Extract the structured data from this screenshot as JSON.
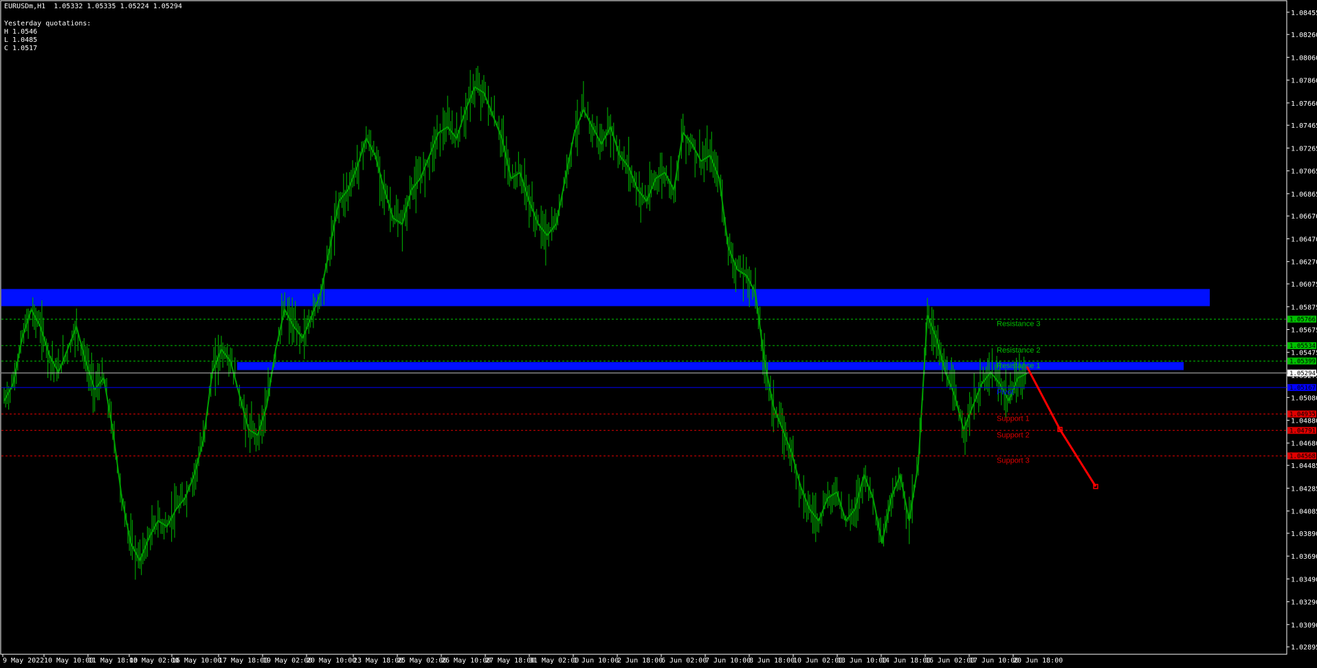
{
  "header": {
    "symbol_line": "EURUSDm,H1  1.05332 1.05335 1.05224 1.05294",
    "yesterday_title": "Yesterday quotations:",
    "yesterday_high": "H 1.0546",
    "yesterday_low": "L 1.0485",
    "yesterday_close": "C 1.0517"
  },
  "colors": {
    "background": "#000000",
    "candles": "#00a000",
    "zone": "#0010ff",
    "resistance": "#00c000",
    "support": "#e00000",
    "pivot": "#0000ff",
    "axis": "#ffffff",
    "forecast_arrow": "#ff0000"
  },
  "chart_data": {
    "type": "line",
    "title": "EURUSDm,H1",
    "ylim": [
      1.0283,
      1.0855
    ],
    "y_ticks": [
      "1.08455",
      "1.08260",
      "1.08060",
      "1.07860",
      "1.07660",
      "1.07465",
      "1.07265",
      "1.07065",
      "1.06865",
      "1.06670",
      "1.06470",
      "1.06270",
      "1.06075",
      "1.05875",
      "1.05675",
      "1.05475",
      "1.05275",
      "1.05080",
      "1.04880",
      "1.04680",
      "1.04485",
      "1.04285",
      "1.04085",
      "1.03890",
      "1.03690",
      "1.03490",
      "1.03290",
      "1.03090",
      "1.02895"
    ],
    "x_ticks": [
      "9 May 2022",
      "10 May 10:00",
      "11 May 18:00",
      "13 May 02:00",
      "16 May 10:00",
      "17 May 18:00",
      "19 May 02:00",
      "20 May 10:00",
      "23 May 18:00",
      "25 May 02:00",
      "26 May 10:00",
      "27 May 18:00",
      "31 May 02:00",
      "1 Jun 10:00",
      "2 Jun 18:00",
      "6 Jun 02:00",
      "7 Jun 10:00",
      "8 Jun 18:00",
      "10 Jun 02:00",
      "13 Jun 10:00",
      "14 Jun 18:00",
      "16 Jun 02:00",
      "17 Jun 10:00",
      "20 Jun 18:00"
    ],
    "series": [
      {
        "values": [
          1.0505,
          1.052,
          1.056,
          1.0585,
          1.057,
          1.0545,
          1.053,
          1.055,
          1.057,
          1.054,
          1.0515,
          1.0525,
          1.048,
          1.042,
          1.038,
          1.0365,
          1.0385,
          1.04,
          1.0395,
          1.041,
          1.042,
          1.044,
          1.047,
          1.053,
          1.055,
          1.054,
          1.051,
          1.048,
          1.0475,
          1.05,
          1.055,
          1.0585,
          1.057,
          1.056,
          1.058,
          1.06,
          1.064,
          1.068,
          1.069,
          1.071,
          1.0735,
          1.072,
          1.069,
          1.0665,
          1.066,
          1.069,
          1.07,
          1.072,
          1.074,
          1.0745,
          1.0735,
          1.076,
          1.078,
          1.0775,
          1.0755,
          1.0735,
          1.07,
          1.0705,
          1.068,
          1.066,
          1.065,
          1.066,
          1.07,
          1.074,
          1.076,
          1.0745,
          1.073,
          1.0745,
          1.072,
          1.071,
          1.069,
          1.068,
          1.07,
          1.0705,
          1.069,
          1.074,
          1.073,
          1.0715,
          1.072,
          1.07,
          1.064,
          1.062,
          1.0615,
          1.06,
          1.054,
          1.05,
          1.048,
          1.046,
          1.043,
          1.041,
          1.04,
          1.042,
          1.0425,
          1.04,
          1.041,
          1.044,
          1.042,
          1.038,
          1.042,
          1.044,
          1.04,
          1.045,
          1.058,
          1.056,
          1.053,
          1.051,
          1.048,
          1.05,
          1.052,
          1.053,
          1.052,
          1.0505,
          1.0525,
          1.0529
        ]
      }
    ],
    "zones": [
      {
        "from": 1.0588,
        "to": 1.0603
      },
      {
        "from": 1.0532,
        "to": 1.0539
      }
    ],
    "levels": [
      {
        "name": "Resistance 3",
        "value": 1.05766,
        "tag": "1.05766",
        "kind": "resistance"
      },
      {
        "name": "Resistance 2",
        "value": 1.05534,
        "tag": "1.05534",
        "kind": "resistance"
      },
      {
        "name": "Resistance 1",
        "value": 1.05399,
        "tag": "1.05399",
        "kind": "resistance"
      },
      {
        "name": "Pivot",
        "value": 1.05167,
        "tag": "1.05167",
        "kind": "pivot"
      },
      {
        "name": "Support 1",
        "value": 1.04935,
        "tag": "1.04935",
        "kind": "support"
      },
      {
        "name": "Support 2",
        "value": 1.04791,
        "tag": "1.04791",
        "kind": "support"
      },
      {
        "name": "Support 3",
        "value": 1.04568,
        "tag": "1.04568",
        "kind": "support"
      }
    ],
    "current_price": {
      "value": 1.05294,
      "tag": "1.05294"
    },
    "forecast": {
      "from": 1.0535,
      "mid": 1.048,
      "to": 1.043
    }
  }
}
